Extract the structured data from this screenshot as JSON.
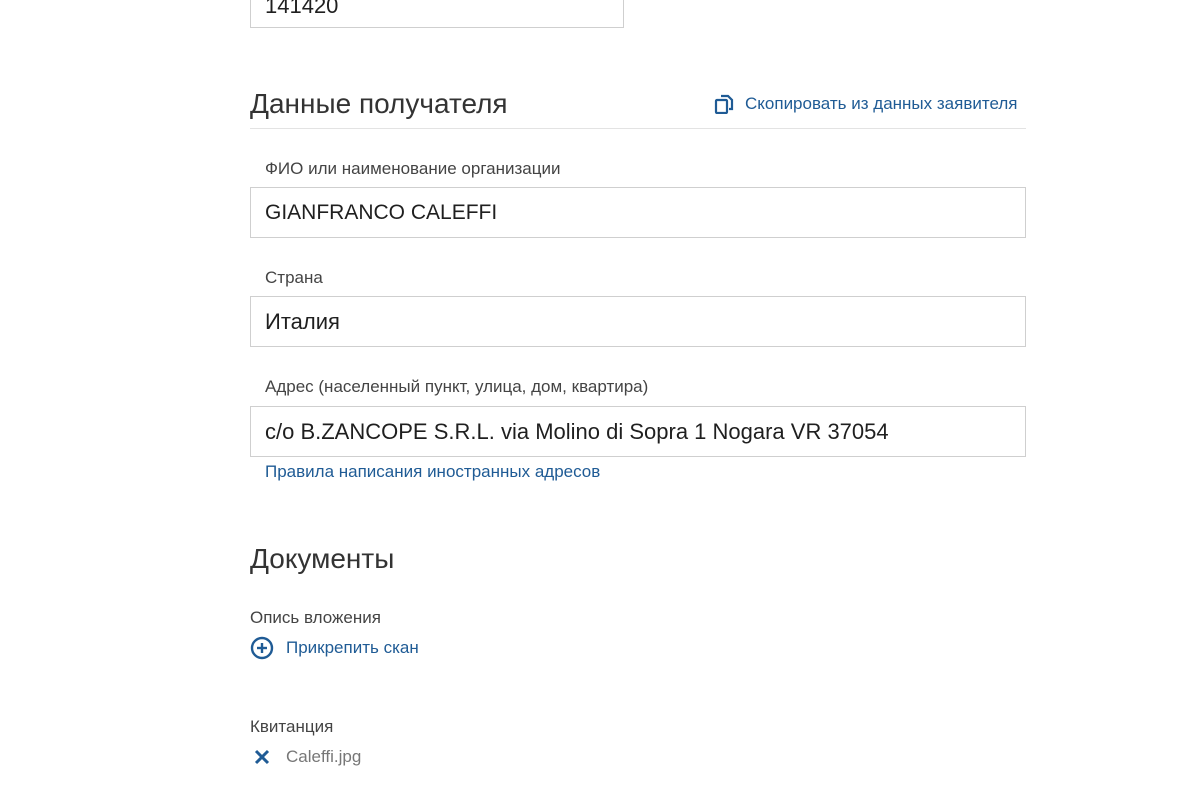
{
  "top_field": {
    "value": "141420"
  },
  "recipient": {
    "heading": "Данные получателя",
    "copy_link": "Скопировать из данных заявителя",
    "copy_icon": "copy-icon",
    "name_label": "ФИО или наименование организации",
    "name_value": "GIANFRANCO CALEFFI",
    "country_label": "Страна",
    "country_value": "Италия",
    "address_label": "Адрес (населенный пункт, улица, дом, квартира)",
    "address_value": "c/o B.ZANCOPE S.R.L. via Molino di Sopra 1 Nogara VR 37054",
    "address_rules_link": "Правила написания иностранных адресов"
  },
  "documents": {
    "heading": "Документы",
    "inventory_label": "Опись вложения",
    "attach_icon": "plus-circle-icon",
    "attach_link": "Прикрепить скан",
    "receipt_label": "Квитанция",
    "remove_icon": "close-icon",
    "receipt_file": "Caleffi.jpg"
  },
  "colors": {
    "accent": "#1f5b95",
    "border": "#cfcfcf",
    "text": "#333333"
  }
}
